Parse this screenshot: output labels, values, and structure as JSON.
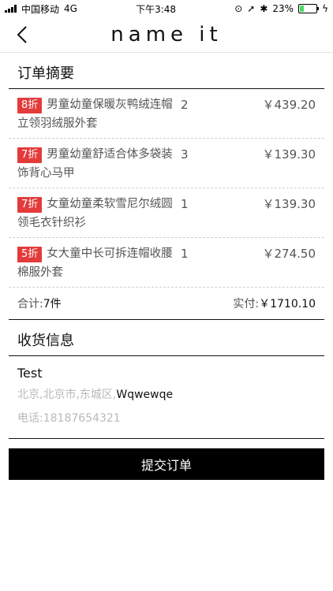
{
  "status": {
    "carrier": "中国移动",
    "network": "4G",
    "time": "下午3:48",
    "battery": "23%",
    "battery_level": 0.23
  },
  "nav": {
    "back_icon": "chevron-left",
    "logo": "name it"
  },
  "order": {
    "title": "订单摘要",
    "items": [
      {
        "discount": "8折",
        "name": "男童幼童保暖灰鸭绒连帽立领羽绒服外套",
        "qty": "2",
        "price": "￥439.20"
      },
      {
        "discount": "7折",
        "name": "男童幼童舒适合体多袋装饰背心马甲",
        "qty": "3",
        "price": "￥139.30"
      },
      {
        "discount": "7折",
        "name": "女童幼童柔软雪尼尔绒圆领毛衣针织衫",
        "qty": "1",
        "price": "￥139.30"
      },
      {
        "discount": "5折",
        "name": "女大童中长可拆连帽收腰棉服外套",
        "qty": "1",
        "price": "￥274.50"
      }
    ],
    "total_label": "合计:",
    "total_count": "7件",
    "paid_label": "实付:",
    "paid_amount": "￥1710.10"
  },
  "shipping": {
    "title": "收货信息",
    "name": "Test",
    "region": "北京,北京市,东城区,",
    "street": "Wqwewqe",
    "phone": "电话:18187654321"
  },
  "actions": {
    "submit_label": "提交订单"
  }
}
